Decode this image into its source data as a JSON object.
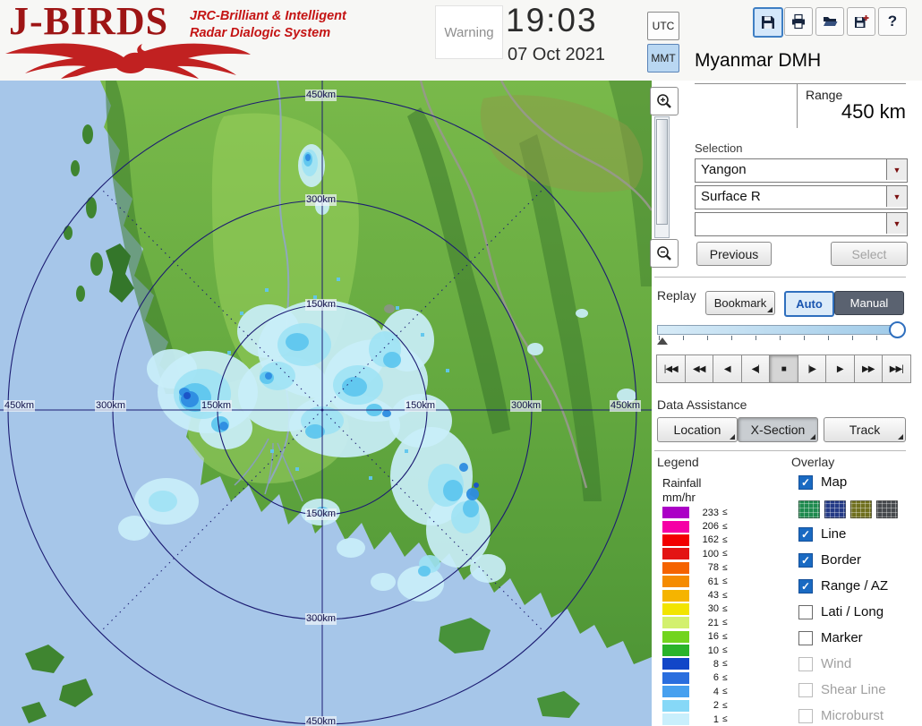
{
  "header": {
    "logo": {
      "title": "J-BIRDS",
      "subtitle_line1": "JRC-Brilliant & Intelligent",
      "subtitle_line2": "Radar  Dialogic  System"
    },
    "warning_label": "Warning",
    "clock": {
      "time": "19:03",
      "date": "07 Oct 2021"
    },
    "timezone": {
      "utc_label": "UTC",
      "mmt_label": "MMT",
      "selected": "MMT"
    },
    "toolbar": {
      "icons": [
        "save-icon",
        "print-icon",
        "open-folder-icon",
        "save-as-icon",
        "help-icon"
      ],
      "help_glyph": "?"
    },
    "station_title": "Myanmar DMH"
  },
  "range_panel": {
    "label": "Range",
    "value": "450 km"
  },
  "selection": {
    "label": "Selection",
    "dropdown_site": "Yangon",
    "dropdown_product": "Surface R",
    "dropdown_extra": "",
    "previous_button": "Previous",
    "select_button": "Select"
  },
  "replay": {
    "label": "Replay",
    "bookmark_button": "Bookmark",
    "auto_button": "Auto",
    "manual_button": "Manual",
    "mode_selected": "Auto",
    "playback": [
      "|◀◀",
      "◀◀",
      "◀",
      "◀|",
      "■",
      "|▶",
      "▶",
      "▶▶",
      "▶▶|"
    ],
    "active_playback": "■"
  },
  "data_assistance": {
    "label": "Data Assistance",
    "location_button": "Location",
    "xsection_button": "X-Section",
    "track_button": "Track"
  },
  "legend": {
    "label": "Legend",
    "title_line1": "Rainfall",
    "title_line2": "mm/hr",
    "lte": "≤",
    "rows": [
      {
        "value": "233",
        "color": "#ab00c6"
      },
      {
        "value": "206",
        "color": "#f500a5"
      },
      {
        "value": "162",
        "color": "#f20000"
      },
      {
        "value": "100",
        "color": "#e31414"
      },
      {
        "value": "78",
        "color": "#f56300"
      },
      {
        "value": "61",
        "color": "#f58b00"
      },
      {
        "value": "43",
        "color": "#f5b400"
      },
      {
        "value": "30",
        "color": "#f2e400"
      },
      {
        "value": "21",
        "color": "#d3f06e"
      },
      {
        "value": "16",
        "color": "#72d41e"
      },
      {
        "value": "10",
        "color": "#2ab32a"
      },
      {
        "value": "8",
        "color": "#1246c8"
      },
      {
        "value": "6",
        "color": "#2a6ede"
      },
      {
        "value": "4",
        "color": "#47a0ef"
      },
      {
        "value": "2",
        "color": "#86d8f7"
      },
      {
        "value": "1",
        "color": "#c9effc"
      }
    ]
  },
  "overlay": {
    "label": "Overlay",
    "items": [
      {
        "label": "Map",
        "checked": true,
        "disabled": false
      },
      {
        "label": "Line",
        "checked": true,
        "disabled": false
      },
      {
        "label": "Border",
        "checked": true,
        "disabled": false
      },
      {
        "label": "Range / AZ",
        "checked": true,
        "disabled": false
      },
      {
        "label": "Lati / Long",
        "checked": false,
        "disabled": false
      },
      {
        "label": "Marker",
        "checked": false,
        "disabled": false
      },
      {
        "label": "Wind",
        "checked": false,
        "disabled": true
      },
      {
        "label": "Shear Line",
        "checked": false,
        "disabled": true
      },
      {
        "label": "Microburst",
        "checked": false,
        "disabled": true
      }
    ],
    "map_swatches": [
      {
        "name": "green-pattern",
        "color": "#1e8a4e"
      },
      {
        "name": "navy-pattern",
        "color": "#243a86"
      },
      {
        "name": "olive-pattern",
        "color": "#70701f"
      },
      {
        "name": "gray-pattern",
        "color": "#46494d"
      }
    ]
  },
  "map": {
    "v_labels": [
      "450km",
      "300km",
      "150km",
      "150km",
      "300km",
      "450km"
    ],
    "h_labels": [
      "450km",
      "300km",
      "150km",
      "150km",
      "300km",
      "450km"
    ]
  },
  "colors": {
    "brand_red": "#b51616",
    "accent_blue": "#2f6fbe",
    "sea": "#a6c6e9",
    "range_ring": "#1c1c72",
    "echo_pale": "#c9eef9",
    "echo_blue": "#2d8ce0"
  }
}
